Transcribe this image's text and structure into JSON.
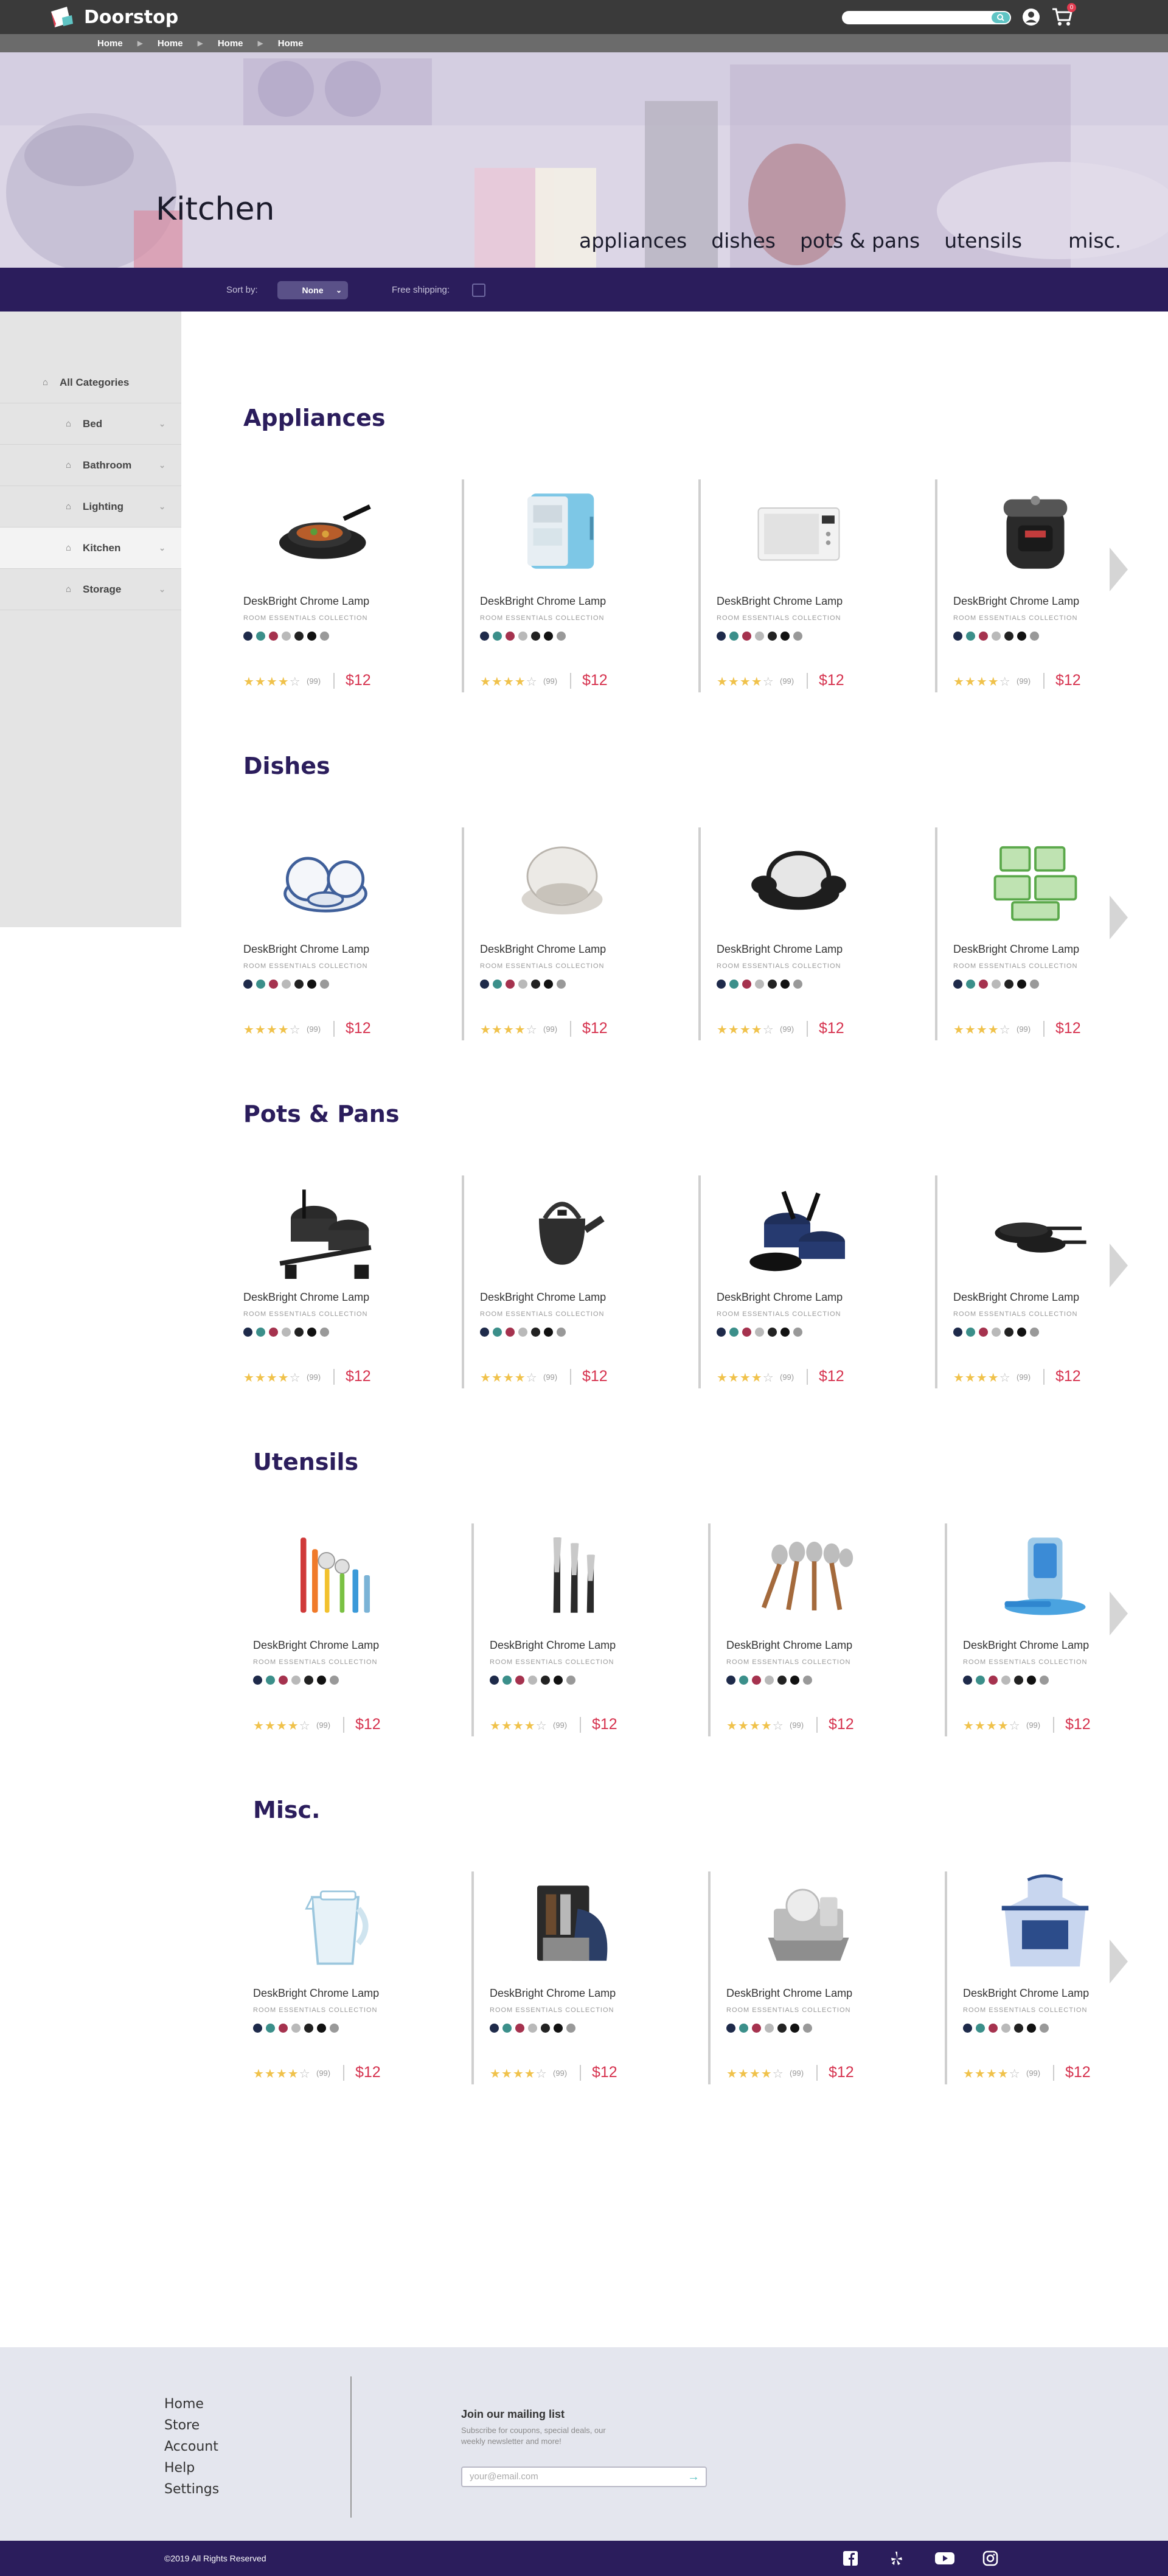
{
  "header": {
    "brand": "Doorstop",
    "cart_count": "0"
  },
  "breadcrumb": [
    "Home",
    "Home",
    "Home",
    "Home"
  ],
  "hero": {
    "title": "Kitchen",
    "categories": [
      "appliances",
      "dishes",
      "pots & pans",
      "utensils",
      "misc."
    ]
  },
  "filters": {
    "sort_label": "Sort by:",
    "sort_value": "None",
    "shipping_label": "Free shipping:"
  },
  "sidebar": {
    "items": [
      {
        "label": "All Categories"
      },
      {
        "label": "Bed"
      },
      {
        "label": "Bathroom"
      },
      {
        "label": "Lighting"
      },
      {
        "label": "Kitchen"
      },
      {
        "label": "Storage"
      }
    ]
  },
  "product": {
    "name": "DeskBright Chrome Lamp",
    "collection": "ROOM ESSENTIALS COLLECTION",
    "reviews": "(99)",
    "price": "$12",
    "rating": 4,
    "swatch_colors": [
      "#1e2a4a",
      "#3b8f8a",
      "#a5324e",
      "#b9b9b9",
      "#222222",
      "#111111",
      "#999999"
    ]
  },
  "sections": [
    {
      "title": "Appliances"
    },
    {
      "title": "Dishes"
    },
    {
      "title": "Pots & Pans"
    },
    {
      "title": "Utensils"
    },
    {
      "title": "Misc."
    }
  ],
  "footer": {
    "links": [
      "Home",
      "Store",
      "Account",
      "Help",
      "Settings"
    ],
    "mailing_title": "Join our mailing list",
    "mailing_sub": "Subscribe for coupons, special deals, our weekly newsletter and more!",
    "email_placeholder": "your@email.com",
    "copyright": "©2019 All Rights Reserved"
  },
  "colors": {
    "brand": "#2b1d5c",
    "price": "#d6334f",
    "accent": "#5fc4c4",
    "star": "#f0c24b"
  }
}
